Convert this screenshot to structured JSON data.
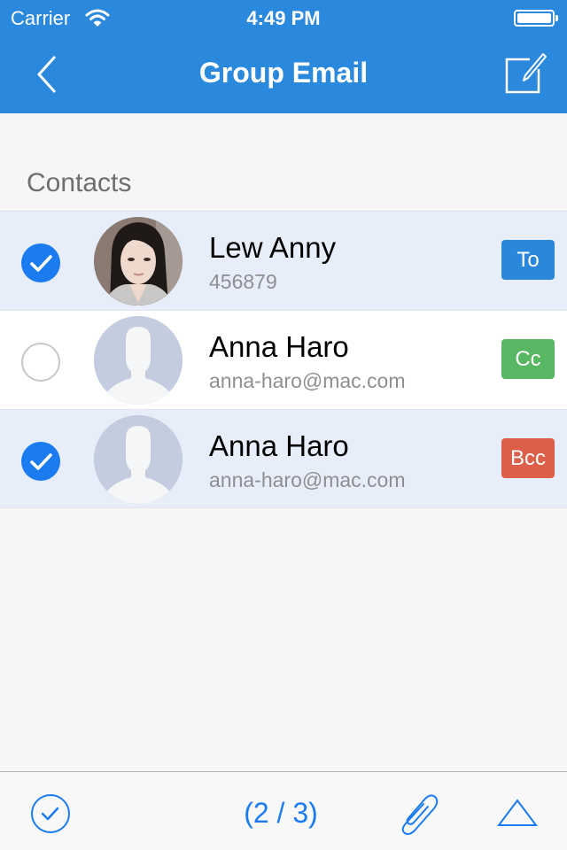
{
  "status_bar": {
    "carrier": "Carrier",
    "time": "4:49 PM",
    "battery_level": 1.0
  },
  "nav": {
    "title": "Group Email",
    "back_icon": "chevron-left-icon",
    "compose_icon": "compose-icon"
  },
  "section": {
    "label": "Contacts"
  },
  "contacts": [
    {
      "name": "Lew Anny",
      "detail": "456879",
      "selected": true,
      "tag": "To",
      "tag_color": "#2a87dc",
      "avatar": "photo"
    },
    {
      "name": "Anna Haro",
      "detail": "anna-haro@mac.com",
      "selected": false,
      "tag": "Cc",
      "tag_color": "#58b763",
      "avatar": "placeholder"
    },
    {
      "name": "Anna Haro",
      "detail": "anna-haro@mac.com",
      "selected": true,
      "tag": "Bcc",
      "tag_color": "#dc5f4a",
      "avatar": "placeholder"
    }
  ],
  "toolbar": {
    "select_all_icon": "check-circle-icon",
    "count": "(2 / 3)",
    "attach_icon": "paperclip-icon",
    "up_icon": "triangle-up-icon"
  },
  "colors": {
    "nav_bg": "#2b89dd",
    "accent": "#1a7cf0",
    "selected_row_bg": "#e8eef9"
  }
}
